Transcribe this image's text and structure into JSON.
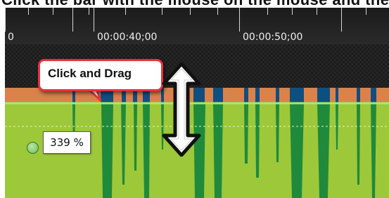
{
  "top_text": "Click the bar with the mouse on the mouse and the",
  "ruler": {
    "labels": [
      "0",
      "00:00:40;00",
      "00:00:50;00"
    ]
  },
  "callout": {
    "text": "Click and Drag"
  },
  "volume_tooltip": {
    "value": "339 %"
  },
  "icons": {
    "volume_handle": "volume-handle-icon",
    "resize_cursor": "vertical-resize-cursor-icon"
  },
  "colors": {
    "waveform_green": "#9dc83a",
    "waveform_dark_green": "#1f8a3c",
    "waveform_orange": "#d9834a",
    "waveform_blue": "#0e4f82",
    "volume_line": "#a6eb6e",
    "callout_border": "#e8323e"
  }
}
